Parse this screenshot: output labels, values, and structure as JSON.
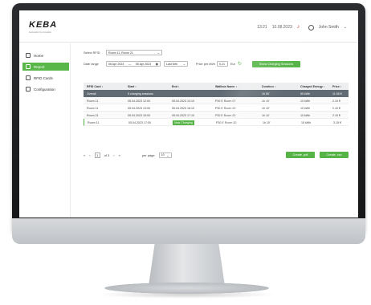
{
  "header": {
    "logo": "KEBA",
    "logo_sub": "Automation by innovation",
    "time": "13:21",
    "date": "10.08.2023",
    "user": "John Smith"
  },
  "sidebar": {
    "items": [
      {
        "label": "Home",
        "icon": "home-icon",
        "active": false
      },
      {
        "label": "Report",
        "icon": "report-icon",
        "active": true
      },
      {
        "label": "RFID Cards",
        "icon": "rfid-card-icon",
        "active": false
      },
      {
        "label": "Configuration",
        "icon": "wrench-icon",
        "active": false
      }
    ]
  },
  "filters": {
    "rfid_label": "Select RFID",
    "rfid_value": "Room 11, Room 21",
    "range_label": "Date range",
    "range_from": "06 Apr 2023",
    "range_sep": "—",
    "range_to": "05 Apr 2023",
    "period_value": "Last Mth",
    "price_label": "Price per kWh",
    "price_value": "0.21",
    "currency": "Eur",
    "show_button": "Show Charging Sessions"
  },
  "table": {
    "headers": [
      "RFID Card ↕",
      "Start ↕",
      "End ↕",
      "Wallbox Name ↕",
      "Duration ↕",
      "Charged Energy ↕",
      "Price ↕"
    ],
    "overall": {
      "label": "Overall",
      "sessions": "5 charging sessions",
      "duration": "1h 50'",
      "energy": "55 kWh",
      "price": "11.55 €"
    },
    "rows": [
      {
        "card": "Room 11",
        "start": "05.04.2023 12:00",
        "end": "05.04.2023 13:10",
        "wallbox": "P30 E Room 07",
        "duration": "1h 10'",
        "energy": "10 kWh",
        "price": "2.10 €",
        "end_pill": false
      },
      {
        "card": "Room 11",
        "start": "05.04.2023 13:00",
        "end": "05.04.2023 16:10",
        "wallbox": "P30 E Room 20",
        "duration": "1h 10'",
        "energy": "10 kWh",
        "price": "2.10 €",
        "end_pill": false
      },
      {
        "card": "Room 21",
        "start": "05.04.2023 15:00",
        "end": "05.04.2023 17:10",
        "wallbox": "P30 E Room 20",
        "duration": "1h 10'",
        "energy": "10 kWh",
        "price": "2.10 €",
        "end_pill": false
      },
      {
        "card": "Room 11",
        "start": "05.04.2023 17:00",
        "end": "Now Charging",
        "wallbox": "P30 E Room 20",
        "duration": "1h 10'",
        "energy": "15 kWh",
        "price": "3.15 €",
        "end_pill": true
      }
    ]
  },
  "pagination": {
    "first": "«",
    "prev": "‹",
    "page": "1",
    "of": "of 3",
    "next": "›",
    "last": "»",
    "per_page_label": "per page",
    "per_page_value": "10"
  },
  "actions": {
    "create_pdf": "Create .pdf",
    "create_csv": "Create .csv"
  },
  "colors": {
    "accent": "#56b447",
    "overall_row": "#616b73",
    "bell": "#c62828"
  }
}
